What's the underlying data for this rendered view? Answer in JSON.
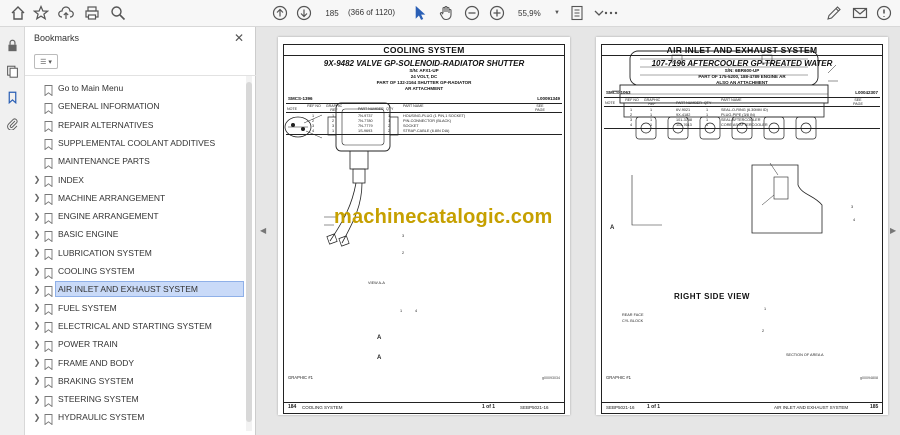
{
  "toolbar": {
    "current_page": "185",
    "page_count": "(366 of 1120)",
    "zoom": "55,9%"
  },
  "bookmarks": {
    "title": "Bookmarks",
    "items": [
      {
        "label": "Go to Main Menu",
        "expandable": false
      },
      {
        "label": "GENERAL INFORMATION",
        "expandable": false
      },
      {
        "label": "REPAIR ALTERNATIVES",
        "expandable": false
      },
      {
        "label": "SUPPLEMENTAL COOLANT ADDITIVES",
        "expandable": false
      },
      {
        "label": "MAINTENANCE PARTS",
        "expandable": false
      },
      {
        "label": "INDEX",
        "expandable": true
      },
      {
        "label": "MACHINE ARRANGEMENT",
        "expandable": true
      },
      {
        "label": "ENGINE ARRANGEMENT",
        "expandable": true
      },
      {
        "label": "BASIC ENGINE",
        "expandable": true
      },
      {
        "label": "LUBRICATION SYSTEM",
        "expandable": true
      },
      {
        "label": "COOLING SYSTEM",
        "expandable": true
      },
      {
        "label": "AIR INLET AND EXHAUST SYSTEM",
        "expandable": true,
        "selected": true
      },
      {
        "label": "FUEL SYSTEM",
        "expandable": true
      },
      {
        "label": "ELECTRICAL AND STARTING SYSTEM",
        "expandable": true
      },
      {
        "label": "POWER TRAIN",
        "expandable": true
      },
      {
        "label": "FRAME AND BODY",
        "expandable": true
      },
      {
        "label": "BRAKING SYSTEM",
        "expandable": true
      },
      {
        "label": "STEERING SYSTEM",
        "expandable": true
      },
      {
        "label": "HYDRAULIC SYSTEM",
        "expandable": true
      }
    ]
  },
  "watermark": "machinecatalogic.com",
  "left_page": {
    "section": "COOLING SYSTEM",
    "title": "9X-9482 VALVE GP-SOLENOID-RADIATOR SHUTTER",
    "sub1": "S/N: AFX1-UP",
    "sub2": "24 VOLT, DC",
    "sub3": "PART OF 132-2164 SHUTTER GP-RADIATOR",
    "sub4": "AR ATTACHMENT",
    "smcs": "SMCS-1396",
    "docnum": "L00091349",
    "headers": {
      "note": "NOTE",
      "ref": "REF NO",
      "graphic": "GRAPHIC REF",
      "part": "PART NUMBER",
      "qty": "QTY",
      "name": "PART NAME",
      "see": "SEE PAGE"
    },
    "rows": [
      {
        "ref": "1",
        "graphic": "1",
        "part": "7N-9737",
        "qty": "1",
        "name": "HOUSING-PLUG (1 PIN,1 SOCKET)"
      },
      {
        "ref": "2",
        "graphic": "2",
        "part": "7N-7780",
        "qty": "1",
        "name": "PIN-CONNECTOR (BLACK)"
      },
      {
        "ref": "3",
        "graphic": "3",
        "part": "7N-7779",
        "qty": "2",
        "name": "SOCKET"
      },
      {
        "ref": "4",
        "graphic": "1",
        "part": "1S-9693",
        "qty": "2",
        "name": "STRAP-CABLE (6.8IN DIA)"
      }
    ],
    "view_label": "VIEW A-A",
    "graphic_label": "GRAPHIC #1",
    "graphic_id": "g00093034",
    "footer_page": "184",
    "footer_section": "COOLING SYSTEM",
    "footer_of": "1 of 1",
    "footer_code": "SEBP5021-16"
  },
  "right_page": {
    "section": "AIR INLET AND EXHAUST SYSTEM",
    "title": "107-7196 AFTERCOOLER GP-TREATED WATER",
    "sub1": "S/N: 6BR600-UP",
    "sub2": "PART OF 175-5200, 188-4789 ENGINE AR",
    "sub3": "ALSO AN ATTACHMENT",
    "smcs": "SMCS-1063",
    "docnum": "L00042307",
    "headers": {
      "note": "NOTE",
      "ref": "REF NO",
      "graphic": "GRAPHIC REF",
      "part": "PART NUMBER",
      "qty": "QTY",
      "name": "PART NAME",
      "see": "SEE PAGE"
    },
    "rows": [
      {
        "ref": "1",
        "graphic": "1",
        "part": "6V-9021",
        "qty": "1",
        "name": "SEAL-O-RING (6.30MM ID)"
      },
      {
        "ref": "2",
        "graphic": "1",
        "part": "9X-4182",
        "qty": "1",
        "name": "PLUG-PIPE (3/8 IN)"
      },
      {
        "ref": "3",
        "graphic": "1",
        "part": "101-3758",
        "qty": "1",
        "name": "SEAL-AFTERCOOLER"
      },
      {
        "ref": "4",
        "graphic": "1",
        "part": "114-7613",
        "qty": "1",
        "name": "CORE AS-AFTERCOOLER"
      }
    ],
    "view_label": "RIGHT SIDE VIEW",
    "rear_face": "REAR FACE",
    "cyl_block": "CYL BLOCK",
    "section_label": "SECTION OF AREA A",
    "graphic_label": "GRAPHIC #1",
    "graphic_id": "g00094808",
    "footer_code": "SEBP5021-16",
    "footer_of": "1 of 1",
    "footer_section": "AIR INLET AND EXHAUST SYSTEM",
    "footer_page": "185"
  },
  "callouts": {
    "one": "1",
    "two": "2",
    "three": "3",
    "four": "4",
    "a": "A"
  }
}
